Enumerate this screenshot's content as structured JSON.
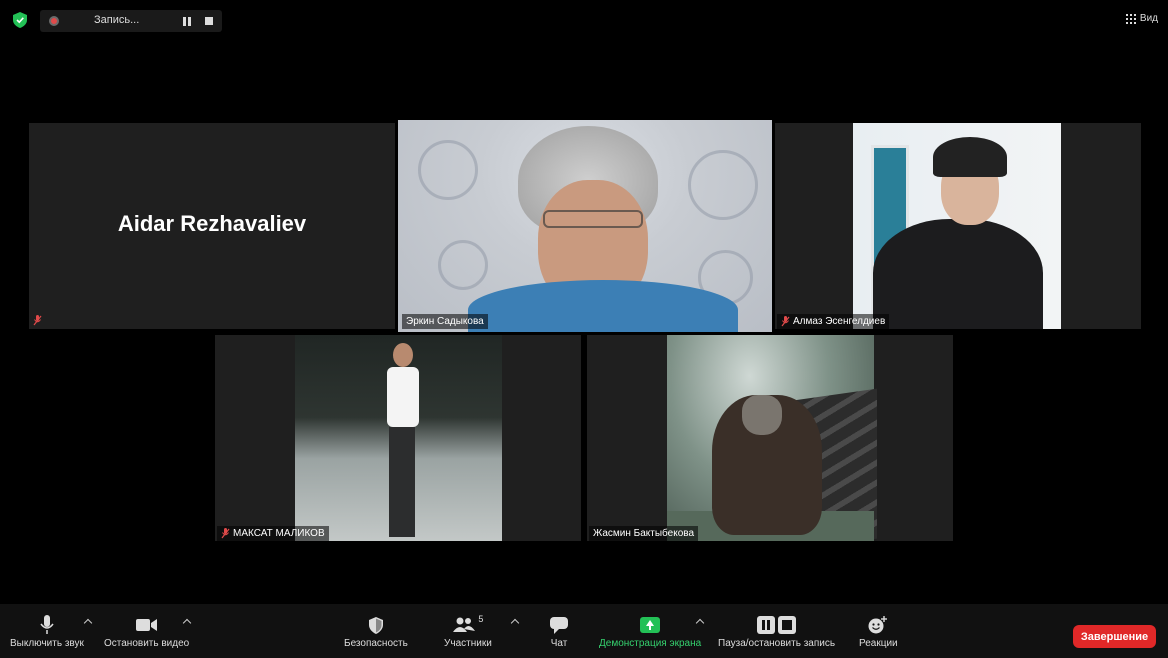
{
  "top_bar": {
    "recording_label": "Запись...",
    "view_label": "Вид"
  },
  "participants": [
    {
      "name": "Aidar Rezhavaliev",
      "video": false,
      "muted": true
    },
    {
      "name": "Эркин Садыкова",
      "video": true,
      "muted": false,
      "active_speaker": true
    },
    {
      "name": "Алмаз Эсенгелдиев",
      "video": true,
      "muted": true
    },
    {
      "name": "МАКСАТ МАЛИКОВ",
      "video": true,
      "muted": true
    },
    {
      "name": "Жасмин Бактыбекова",
      "video": true,
      "muted": false
    }
  ],
  "toolbar": {
    "mute_label": "Выключить звук",
    "video_label": "Остановить видео",
    "security_label": "Безопасность",
    "participants_label": "Участники",
    "participants_count": "5",
    "chat_label": "Чат",
    "share_label": "Демонстрация экрана",
    "record_label": "Пауза/остановить запись",
    "reactions_label": "Реакции",
    "end_label": "Завершение"
  },
  "colors": {
    "active_speaker_outline": "#b9e36b",
    "share_green": "#23c056",
    "end_red": "#e02828",
    "muted_red": "#e04a4a"
  }
}
